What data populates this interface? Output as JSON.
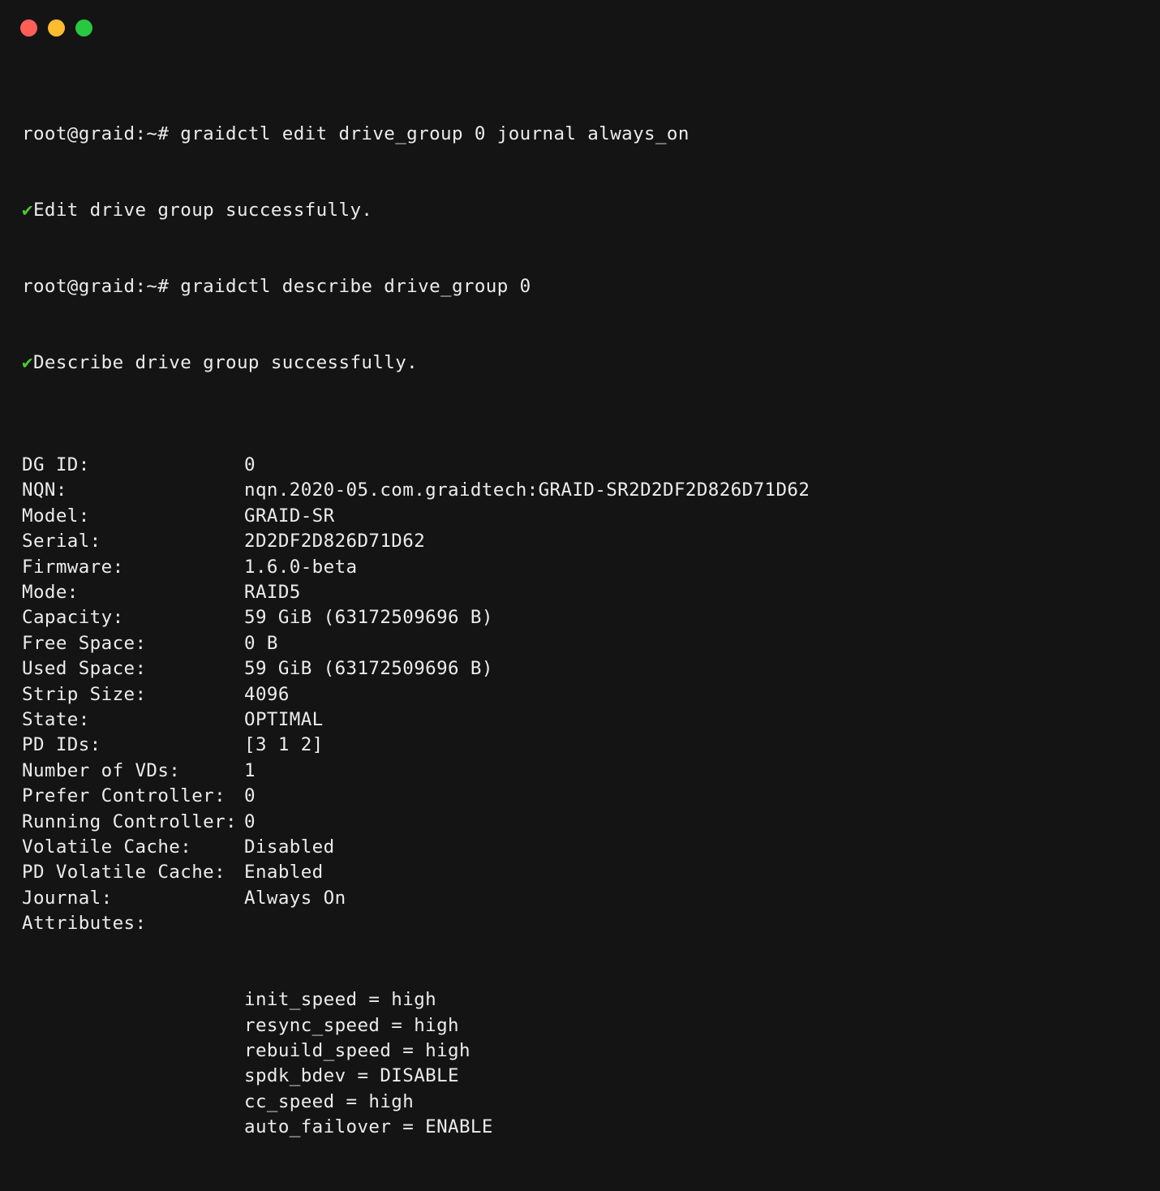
{
  "window": {
    "controls": {
      "close_color": "#ff5f57",
      "minimize_color": "#febc2e",
      "zoom_color": "#28c840"
    }
  },
  "colors": {
    "background": "#141414",
    "text": "#ececec",
    "success": "#4ec732"
  },
  "terminal": {
    "cmd1": {
      "prompt": "root@graid:~# ",
      "command": "graidctl edit drive_group 0 journal always_on"
    },
    "out1": {
      "icon": "✔",
      "text": "Edit drive group successfully."
    },
    "cmd2": {
      "prompt": "root@graid:~# ",
      "command": "graidctl describe drive_group 0"
    },
    "out2": {
      "icon": "✔",
      "text": "Describe drive group successfully."
    },
    "fields": [
      {
        "key": "DG ID:",
        "value": "0"
      },
      {
        "key": "NQN:",
        "value": "nqn.2020-05.com.graidtech:GRAID-SR2D2DF2D826D71D62"
      },
      {
        "key": "Model:",
        "value": "GRAID-SR"
      },
      {
        "key": "Serial:",
        "value": "2D2DF2D826D71D62"
      },
      {
        "key": "Firmware:",
        "value": "1.6.0-beta"
      },
      {
        "key": "Mode:",
        "value": "RAID5"
      },
      {
        "key": "Capacity:",
        "value": "59 GiB (63172509696 B)"
      },
      {
        "key": "Free Space:",
        "value": "0 B"
      },
      {
        "key": "Used Space:",
        "value": "59 GiB (63172509696 B)"
      },
      {
        "key": "Strip Size:",
        "value": "4096"
      },
      {
        "key": "State:",
        "value": "OPTIMAL"
      },
      {
        "key": "PD IDs:",
        "value": "[3 1 2]"
      },
      {
        "key": "Number of VDs:",
        "value": "1"
      },
      {
        "key": "Prefer Controller:",
        "value": "0"
      },
      {
        "key": "Running Controller:",
        "value": "0"
      },
      {
        "key": "Volatile Cache:",
        "value": "Disabled"
      },
      {
        "key": "PD Volatile Cache:",
        "value": "Enabled"
      },
      {
        "key": "Journal:",
        "value": "Always On"
      },
      {
        "key": "Attributes:",
        "value": ""
      }
    ],
    "attributes": [
      "init_speed = high",
      "resync_speed = high",
      "rebuild_speed = high",
      "spdk_bdev = DISABLE",
      "cc_speed = high",
      "auto_failover = ENABLE"
    ]
  }
}
